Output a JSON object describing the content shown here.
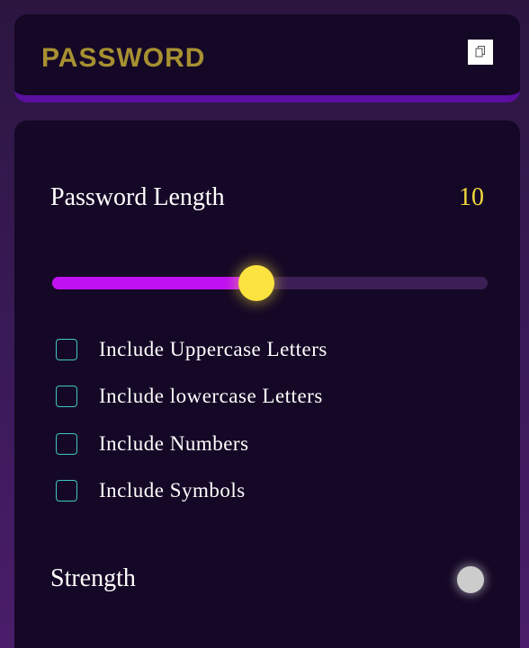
{
  "display": {
    "password_text": "PASSWORD",
    "copy_icon": "copy-icon"
  },
  "length": {
    "label": "Password Length",
    "value": "10",
    "slider_fraction": 0.47
  },
  "options": [
    {
      "label": "Include Uppercase Letters",
      "checked": false
    },
    {
      "label": "Include lowercase Letters",
      "checked": false
    },
    {
      "label": "Include Numbers",
      "checked": false
    },
    {
      "label": "Include Symbols",
      "checked": false
    }
  ],
  "strength": {
    "label": "Strength",
    "indicator_color": "#cccccc"
  },
  "colors": {
    "accent_yellow": "#f3d93b",
    "accent_purple": "#c012f0",
    "password_gold": "#a79131",
    "checkbox_teal": "#3fc7c3",
    "card_bg": "#150826"
  }
}
